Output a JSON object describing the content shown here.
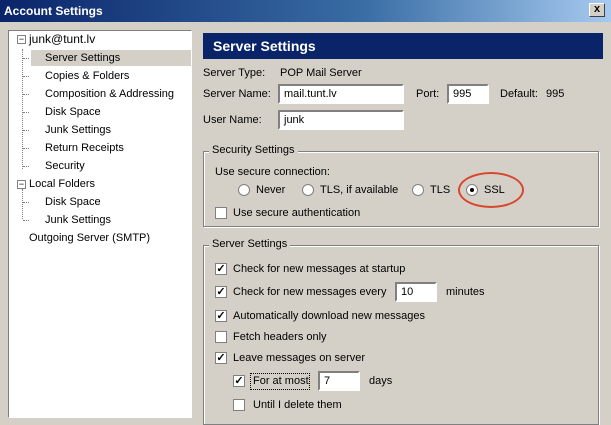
{
  "window": {
    "title": "Account Settings",
    "close_glyph": "x"
  },
  "tree": {
    "account": "junk@tunt.lv",
    "account_items": [
      "Server Settings",
      "Copies & Folders",
      "Composition & Addressing",
      "Disk Space",
      "Junk Settings",
      "Return Receipts",
      "Security"
    ],
    "local_folders": "Local Folders",
    "local_items": [
      "Disk Space",
      "Junk Settings"
    ],
    "outgoing": "Outgoing Server (SMTP)",
    "expand_glyph": "−"
  },
  "panel": {
    "title": "Server Settings",
    "server_type_label": "Server Type:",
    "server_type_value": "POP Mail Server",
    "server_name_label": "Server Name:",
    "server_name_value": "mail.tunt.lv",
    "port_label": "Port:",
    "port_value": "995",
    "default_label": "Default:",
    "default_value": "995",
    "user_name_label": "User Name:",
    "user_name_value": "junk"
  },
  "security": {
    "legend": "Security Settings",
    "use_secure_label": "Use secure connection:",
    "options": [
      {
        "label": "Never",
        "selected": false
      },
      {
        "label": "TLS, if available",
        "selected": false
      },
      {
        "label": "TLS",
        "selected": false
      },
      {
        "label": "SSL",
        "selected": true
      }
    ],
    "secure_auth_label": "Use secure authentication",
    "secure_auth_checked": false
  },
  "server_settings": {
    "legend": "Server Settings",
    "check_startup": "Check for new messages at startup",
    "check_every": "Check for new messages every",
    "check_every_value": "10",
    "minutes": "minutes",
    "auto_download": "Automatically download new messages",
    "fetch_headers": "Fetch headers only",
    "leave_on_server": "Leave messages on server",
    "for_at_most": "For at most",
    "days_value": "7",
    "days": "days",
    "until_delete": "Until I delete them"
  },
  "glyphs": {
    "check": "✓"
  },
  "colors": {
    "selection_ring": "#d9462c",
    "header": "#0a246a"
  }
}
